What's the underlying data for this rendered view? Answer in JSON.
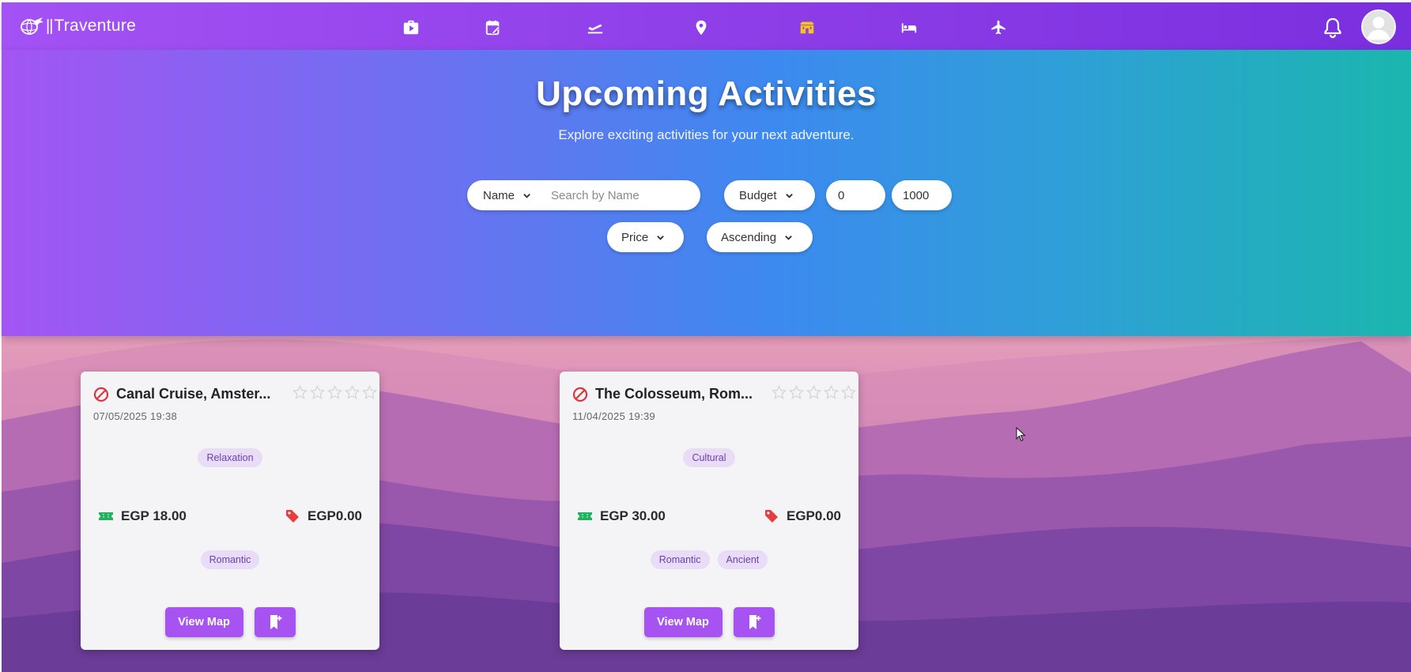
{
  "navbar": {
    "brand_bars": "||",
    "brand_name": "Traventure",
    "icons": [
      "briefcase-icon",
      "calendar-edit-icon",
      "plane-departure-icon",
      "location-pin-icon",
      "museum-icon",
      "bed-icon",
      "airplane-icon"
    ],
    "active_icon": "museum-icon",
    "active_color": "#f5c518"
  },
  "hero": {
    "title": "Upcoming Activities",
    "subtitle": "Explore exciting activities for your next adventure."
  },
  "filters": {
    "search_field": "Name",
    "search_placeholder": "Search by Name",
    "budget_label": "Budget",
    "min_value": "0",
    "max_value": "1000",
    "sort_field": "Price",
    "sort_order": "Ascending"
  },
  "cards": [
    {
      "title": "Canal Cruise, Amster...",
      "date": "07/05/2025 19:38",
      "category": "Relaxation",
      "price": "EGP 18.00",
      "discount": "EGP0.00",
      "tags": [
        "Romantic"
      ],
      "rating": 0,
      "map_label": "View Map"
    },
    {
      "title": "The Colosseum, Rom...",
      "date": "11/04/2025 19:39",
      "category": "Cultural",
      "price": "EGP 30.00",
      "discount": "EGP0.00",
      "tags": [
        "Romantic",
        "Ancient"
      ],
      "rating": 0,
      "map_label": "View Map"
    }
  ],
  "colors": {
    "accent": "#a653f2",
    "nav": "#8f3fe8",
    "ticket": "#22b35e",
    "discount_tag": "#e53e3e",
    "ban": "#d9363e"
  }
}
